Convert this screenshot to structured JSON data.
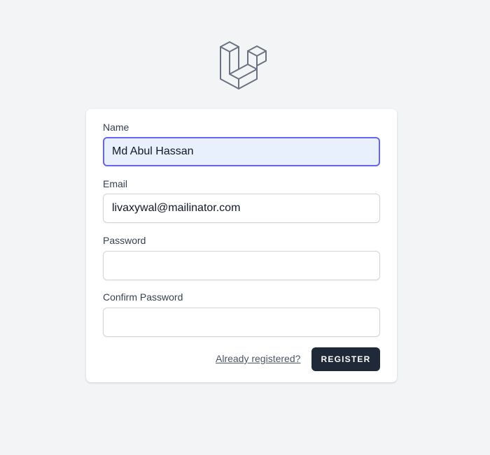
{
  "logo": {
    "icon": "laravel-logo-icon",
    "color": "#6b7280"
  },
  "form": {
    "name": {
      "label": "Name",
      "value": "Md Abul Hassan"
    },
    "email": {
      "label": "Email",
      "value": "livaxywal@mailinator.com"
    },
    "password": {
      "label": "Password",
      "value": ""
    },
    "confirm_password": {
      "label": "Confirm Password",
      "value": ""
    },
    "login_link": "Already registered?",
    "register_button": "REGISTER"
  },
  "colors": {
    "background": "#f3f4f6",
    "focus_ring": "#6366f1",
    "button": "#1f2937"
  }
}
